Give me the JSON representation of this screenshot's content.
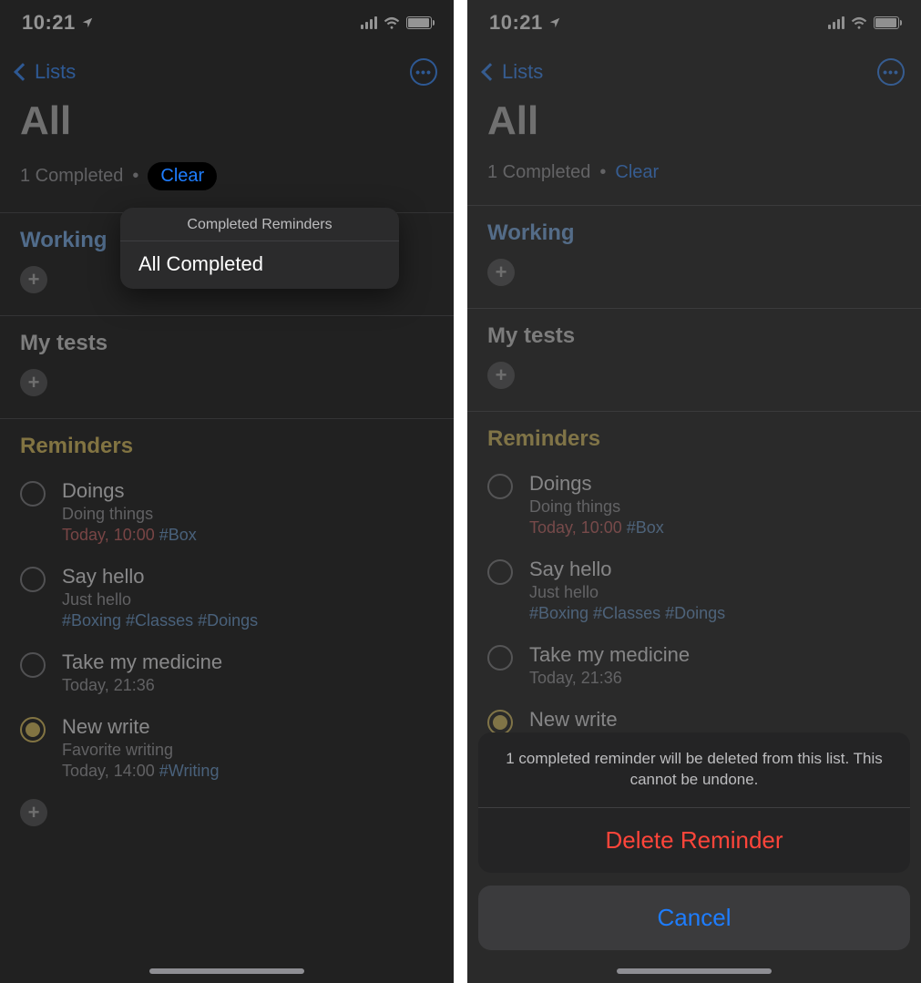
{
  "statusbar": {
    "time": "10:21"
  },
  "nav": {
    "back_label": "Lists"
  },
  "header": {
    "title": "All",
    "completed_text": "1 Completed",
    "clear_label": "Clear"
  },
  "sections": {
    "working": {
      "title": "Working"
    },
    "mytests": {
      "title": "My tests"
    },
    "reminders": {
      "title": "Reminders",
      "items": [
        {
          "title": "Doings",
          "sub": "Doing things",
          "due": "Today, 10:00",
          "tag": "#Box",
          "checked": false
        },
        {
          "title": "Say hello",
          "sub": "Just hello",
          "tags_line": "#Boxing #Classes #Doings",
          "checked": false
        },
        {
          "title": "Take my medicine",
          "sub": "Today, 21:36",
          "checked": false
        },
        {
          "title": "New write",
          "sub": "Favorite writing",
          "due_plain": "Today, 14:00",
          "tag": "#Writing",
          "checked": true
        }
      ]
    }
  },
  "popup": {
    "title": "Completed Reminders",
    "item": "All Completed"
  },
  "sheet": {
    "message": "1 completed reminder will be deleted from this list. This cannot be undone.",
    "delete_label": "Delete Reminder",
    "cancel_label": "Cancel"
  }
}
